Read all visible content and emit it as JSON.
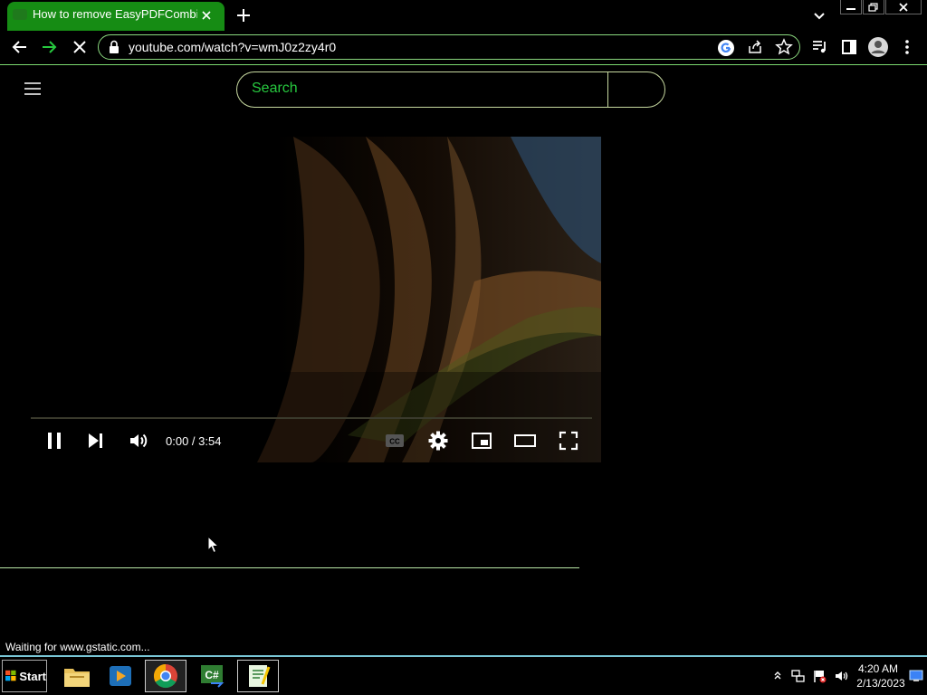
{
  "browser": {
    "tab_title": "How to remove EasyPDFCombine",
    "url": "youtube.com/watch?v=wmJ0z2zy4r0",
    "status": "Waiting for www.gstatic.com..."
  },
  "youtube": {
    "search_placeholder": "Search"
  },
  "player": {
    "time": "0:00 / 3:54",
    "progress": 0
  },
  "taskbar": {
    "start_label": "Start",
    "apps": [
      "explorer",
      "media-player",
      "chrome",
      "csharp",
      "editor"
    ]
  },
  "clock": {
    "time": "4:20 AM",
    "date": "2/13/2023"
  },
  "colors": {
    "tab_active": "#168c14",
    "accent_green": "#27c93f",
    "omnibox_border": "#8ad87e"
  }
}
